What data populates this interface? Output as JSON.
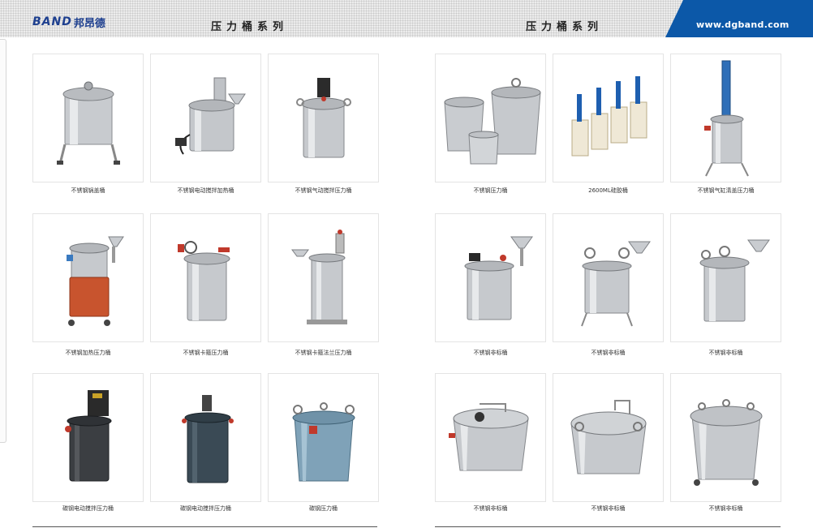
{
  "header": {
    "logo_text": "BAND",
    "logo_cn": "邦昂德",
    "title_left": "压力桶系列",
    "title_right": "压力桶系列",
    "website": "www.dgband.com",
    "brand_color": "#0c58a8"
  },
  "products": [
    {
      "caption": "不锈钢锅盖桶"
    },
    {
      "caption": "不锈钢电动搅拌加热桶"
    },
    {
      "caption": "不锈钢气动搅拌压力桶"
    },
    {
      "caption": "不锈钢压力桶"
    },
    {
      "caption": "2600ML硅胶桶"
    },
    {
      "caption": "不锈钢气缸清盖压力桶"
    },
    {
      "caption": "不锈钢加热压力桶"
    },
    {
      "caption": "不锈钢卡箍压力桶"
    },
    {
      "caption": "不锈钢卡箍法兰压力桶"
    },
    {
      "caption": "不锈钢非标桶"
    },
    {
      "caption": "不锈钢非标桶"
    },
    {
      "caption": "不锈钢非标桶"
    },
    {
      "caption": "碳钢电动搅拌压力桶"
    },
    {
      "caption": "碳钢电动搅拌压力桶"
    },
    {
      "caption": "碳钢压力桶"
    },
    {
      "caption": "不锈钢非标桶"
    },
    {
      "caption": "不锈钢非标桶"
    },
    {
      "caption": "不锈钢非标桶"
    }
  ]
}
